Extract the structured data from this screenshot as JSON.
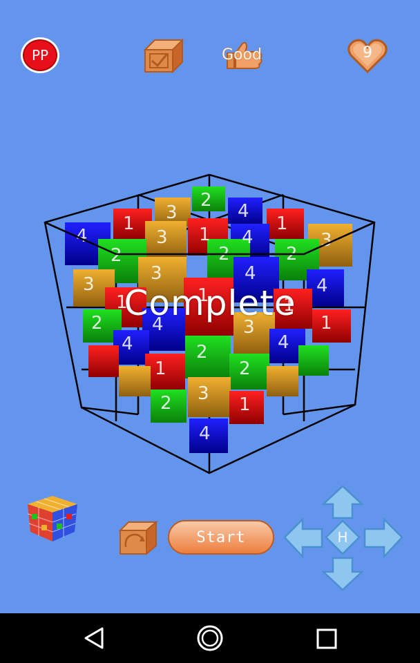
{
  "header": {
    "pp_label": "PP",
    "rating_label": "Good",
    "lives_count": "9"
  },
  "status": {
    "overlay_text": "Complete"
  },
  "controls": {
    "start_label": "Start",
    "home_label": "H"
  },
  "colors": {
    "background": "#6495ed",
    "accent_orange": "#ee7e3e",
    "cube_red": "#e01010",
    "cube_green": "#10c010",
    "cube_blue": "#1010d0",
    "cube_orange": "#e0a020"
  },
  "icons": [
    "pp-icon",
    "checkbox-cube-icon",
    "thumbs-up-icon",
    "heart-icon",
    "mini-cube-icon",
    "rotate-cube-icon",
    "arrow-up-icon",
    "arrow-down-icon",
    "arrow-left-icon",
    "arrow-right-icon",
    "back-icon",
    "home-icon",
    "recents-icon"
  ]
}
